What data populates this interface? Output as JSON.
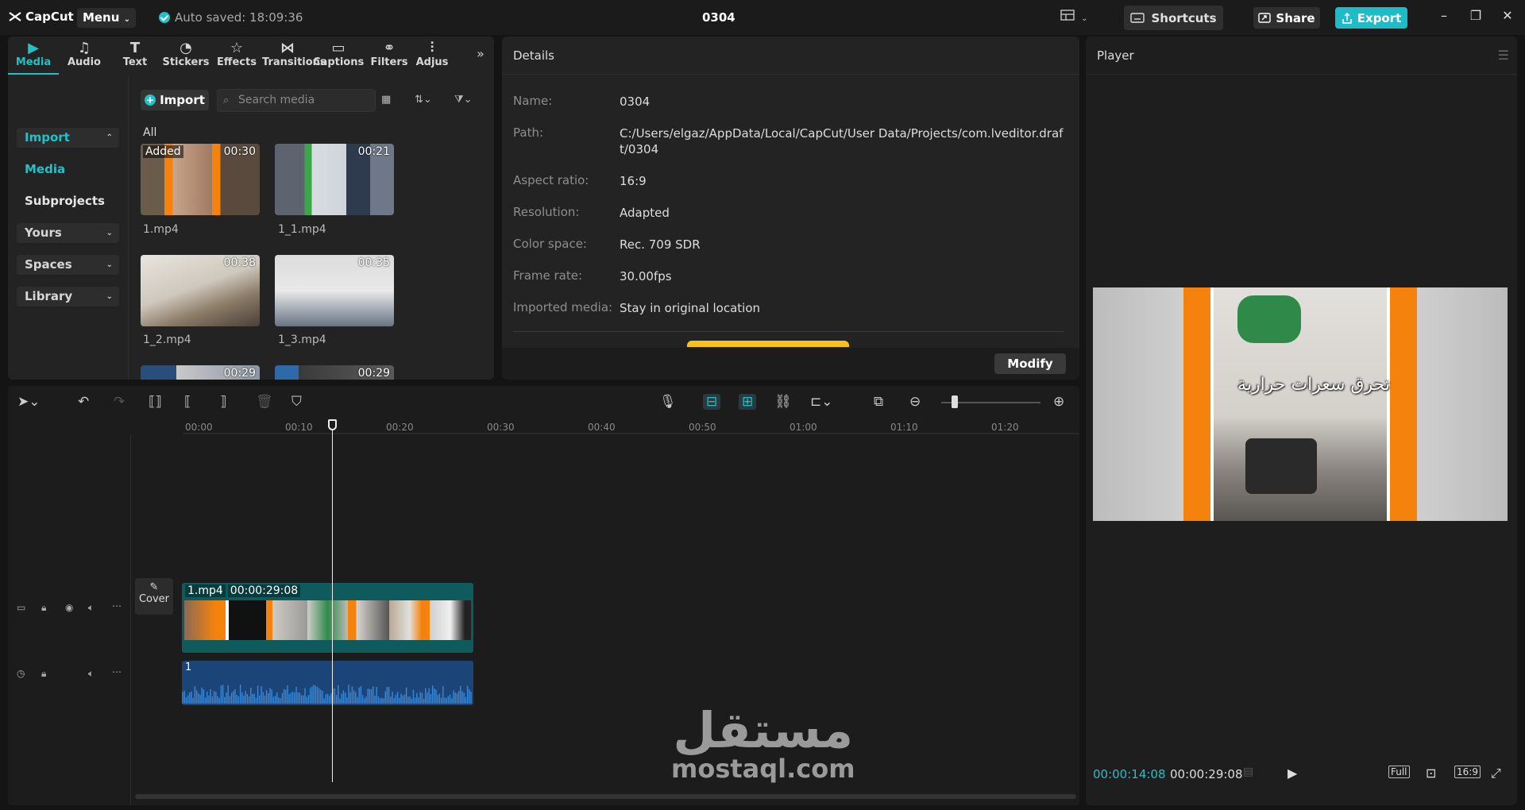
{
  "app": {
    "logo": "CapCut",
    "menu": "Menu",
    "autosave": "Auto saved: 18:09:36",
    "project_title": "0304"
  },
  "header": {
    "shortcuts": "Shortcuts",
    "share": "Share",
    "export": "Export"
  },
  "tools": [
    {
      "label": "Media",
      "icon": "media-icon"
    },
    {
      "label": "Audio",
      "icon": "audio-icon"
    },
    {
      "label": "Text",
      "icon": "text-icon"
    },
    {
      "label": "Stickers",
      "icon": "stickers-icon"
    },
    {
      "label": "Effects",
      "icon": "effects-icon"
    },
    {
      "label": "Transitions",
      "icon": "transitions-icon"
    },
    {
      "label": "Captions",
      "icon": "captions-icon"
    },
    {
      "label": "Filters",
      "icon": "filters-icon"
    },
    {
      "label": "Adjus",
      "icon": "adjust-icon"
    }
  ],
  "sidebar": {
    "import": "Import",
    "media": "Media",
    "subprojects": "Subprojects",
    "yours": "Yours",
    "spaces": "Spaces",
    "library": "Library"
  },
  "media_panel": {
    "import_button": "Import",
    "search_placeholder": "Search media",
    "all_label": "All",
    "added_badge": "Added",
    "items": [
      {
        "name": "1.mp4",
        "duration": "00:30"
      },
      {
        "name": "1_1.mp4",
        "duration": "00:21"
      },
      {
        "name": "1_2.mp4",
        "duration": "00:38"
      },
      {
        "name": "1_3.mp4",
        "duration": "00:35"
      },
      {
        "name": "",
        "duration": "00:29"
      },
      {
        "name": "",
        "duration": "00:29"
      }
    ]
  },
  "details": {
    "title": "Details",
    "rows": [
      {
        "key": "Name:",
        "value": "0304"
      },
      {
        "key": "Path:",
        "value": "C:/Users/elgaz/AppData/Local/CapCut/User Data/Projects/com.lveditor.draft/0304"
      },
      {
        "key": "Aspect ratio:",
        "value": "16:9"
      },
      {
        "key": "Resolution:",
        "value": "Adapted"
      },
      {
        "key": "Color space:",
        "value": "Rec. 709 SDR"
      },
      {
        "key": "Frame rate:",
        "value": "30.00fps"
      },
      {
        "key": "Imported media:",
        "value": "Stay in original location"
      }
    ],
    "modify": "Modify"
  },
  "player": {
    "title": "Player",
    "caption": "تحرق سعرات حرارية",
    "current_time": "00:00:14:08",
    "total_time": "00:00:29:08",
    "full_label": "Full",
    "ratio_label": "16:9"
  },
  "timeline": {
    "ruler": [
      "00:00",
      "00:10",
      "00:20",
      "00:30",
      "00:40",
      "00:50",
      "01:00",
      "01:10",
      "01:20"
    ],
    "cover_label": "Cover",
    "video_clip": {
      "name": "1.mp4",
      "duration": "00:00:29:08"
    },
    "audio_clip": {
      "name": "1"
    }
  },
  "watermark": {
    "arabic": "مستقل",
    "latin": "mostaql.com"
  },
  "colors": {
    "accent": "#22c0c8",
    "video_clip": "#0f5a5c",
    "audio_clip": "#1b4478",
    "frame_orange": "#f5820d"
  }
}
